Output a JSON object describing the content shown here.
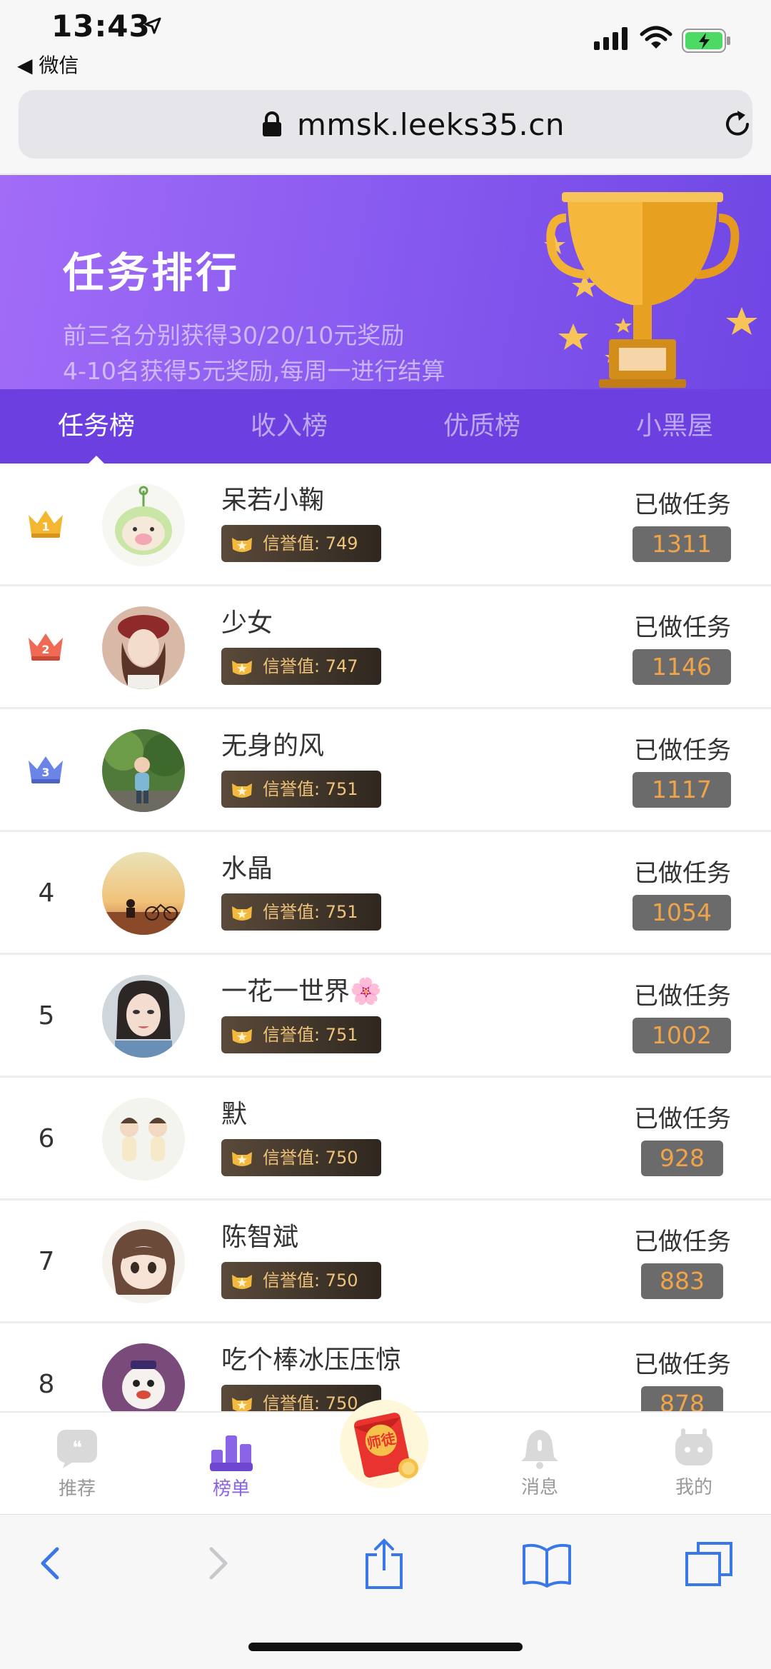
{
  "status_bar": {
    "time": "13:43",
    "back_app": "◀ 微信"
  },
  "browser": {
    "url": "mmsk.leeks35.cn"
  },
  "banner": {
    "title": "任务排行",
    "line1": "前三名分别获得30/20/10元奖励",
    "line2": "4-10名获得5元奖励,每周一进行结算"
  },
  "tabs": [
    {
      "label": "任务榜",
      "active": true
    },
    {
      "label": "收入榜",
      "active": false
    },
    {
      "label": "优质榜",
      "active": false
    },
    {
      "label": "小黑屋",
      "active": false
    }
  ],
  "list": {
    "done_label": "已做任务",
    "credit_prefix": "信誉值: ",
    "rows": [
      {
        "rank": "1",
        "name": "呆若小鞠",
        "credit": "749",
        "done": "1311"
      },
      {
        "rank": "2",
        "name": "少女",
        "credit": "747",
        "done": "1146"
      },
      {
        "rank": "3",
        "name": "无身的风",
        "credit": "751",
        "done": "1117"
      },
      {
        "rank": "4",
        "name": "水晶",
        "credit": "751",
        "done": "1054"
      },
      {
        "rank": "5",
        "name": "一花一世界🌸",
        "credit": "751",
        "done": "1002"
      },
      {
        "rank": "6",
        "name": "默",
        "credit": "750",
        "done": "928"
      },
      {
        "rank": "7",
        "name": "陈智斌",
        "credit": "750",
        "done": "883"
      },
      {
        "rank": "8",
        "name": "吃个棒冰压压惊",
        "credit": "750",
        "done": "878"
      }
    ]
  },
  "bottom_nav": [
    {
      "label": "推荐",
      "icon": "quote-bubble-icon"
    },
    {
      "label": "榜单",
      "icon": "ranking-podium-icon",
      "active": true
    },
    {
      "label": "师徒",
      "icon": "red-envelope-icon"
    },
    {
      "label": "消息",
      "icon": "bell-icon"
    },
    {
      "label": "我的",
      "icon": "robot-face-icon"
    }
  ],
  "colors": {
    "banner_start": "#a26cf7",
    "banner_end": "#6f46e4",
    "tab_bar": "#6c3fe0",
    "count_text": "#f0a44a",
    "credit_text": "#f0c37a",
    "nav_active": "#8b63e6"
  }
}
